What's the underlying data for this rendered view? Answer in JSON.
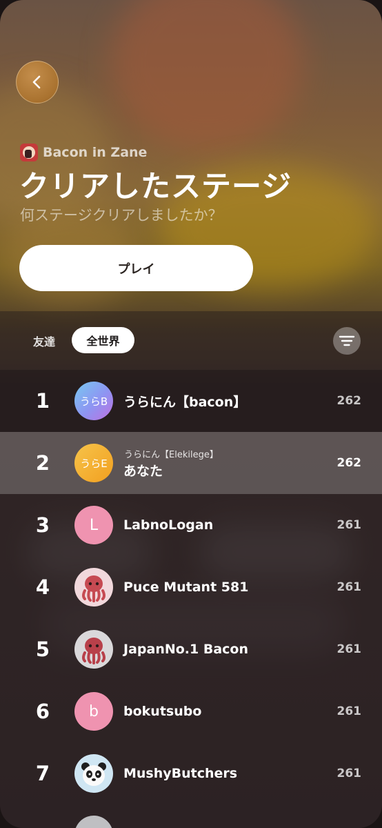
{
  "header": {
    "game_name": "Bacon in Zane",
    "title": "クリアしたステージ",
    "subtitle": "何ステージクリアしましたか？",
    "play_label": "プレイ"
  },
  "tabs": {
    "friends": "友達",
    "world": "全世界"
  },
  "leaderboard": [
    {
      "rank": "1",
      "avatar_text": "うらB",
      "name": "うらにん【bacon】",
      "score": "262"
    },
    {
      "rank": "2",
      "avatar_text": "うらE",
      "sub_name": "うらにん【Elekilege】",
      "name": "あなた",
      "score": "262"
    },
    {
      "rank": "3",
      "avatar_text": "L",
      "name": "LabnoLogan",
      "score": "261"
    },
    {
      "rank": "4",
      "name": "Puce Mutant 581",
      "score": "261"
    },
    {
      "rank": "5",
      "name": "JapanNo.1 Bacon",
      "score": "261"
    },
    {
      "rank": "6",
      "avatar_text": "b",
      "name": "bokutsubo",
      "score": "261"
    },
    {
      "rank": "7",
      "name": "MushyButchers",
      "score": "261"
    }
  ],
  "icons": {
    "back": "chevron-left-icon",
    "filter": "filter-lines-icon",
    "octopus": "octopus-memoji-icon",
    "panda": "panda-memoji-icon"
  },
  "colors": {
    "accent_back": "#a9722f",
    "highlight_row": "rgba(255,255,255,0.22)"
  }
}
